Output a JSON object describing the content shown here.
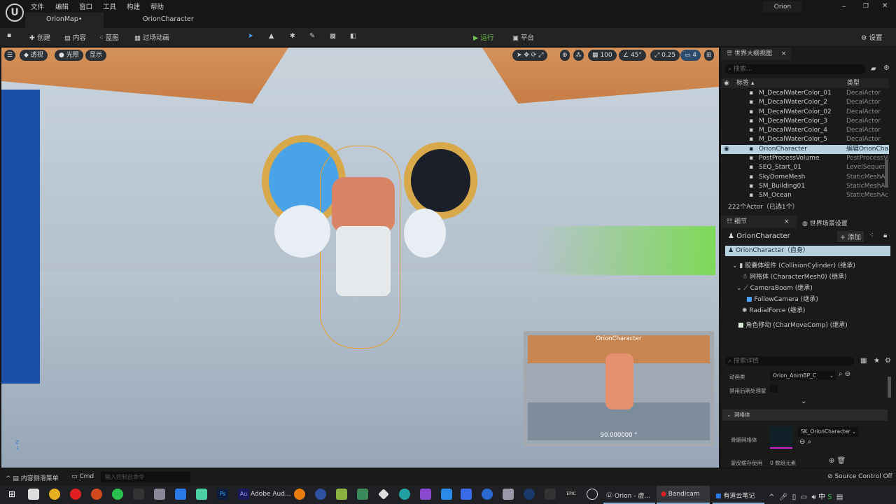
{
  "menu": [
    "文件",
    "编辑",
    "窗口",
    "工具",
    "构建",
    "帮助"
  ],
  "tabs": [
    {
      "label": "OrionMap•"
    },
    {
      "label": "OrionCharacter"
    }
  ],
  "project": "Orion",
  "toolbar": {
    "create": "创建",
    "content": "内容",
    "blueprint": "蓝图",
    "cinematics": "过场动画",
    "play": "运行",
    "platform": "平台",
    "settings": "设置"
  },
  "viewport": {
    "perspective": "透视",
    "lighting": "光照",
    "show": "显示",
    "grid": "100",
    "angle": "45°",
    "scale": "0.25",
    "camera_speed": "4",
    "preview_title": "OrionCharacter",
    "preview_value": "90.000000 °"
  },
  "outliner": {
    "title": "世界大纲视图",
    "search_placeholder": "搜索...",
    "col_label": "标签",
    "col_type": "类型",
    "rows": [
      {
        "name": "M_DecalWaterColor_01",
        "type": "DecalActor"
      },
      {
        "name": "M_DecalWaterColor_2",
        "type": "DecalActor"
      },
      {
        "name": "M_DecalWaterColor_02",
        "type": "DecalActor"
      },
      {
        "name": "M_DecalWaterColor_3",
        "type": "DecalActor"
      },
      {
        "name": "M_DecalWaterColor_4",
        "type": "DecalActor"
      },
      {
        "name": "M_DecalWaterColor_5",
        "type": "DecalActor"
      },
      {
        "name": "OrionCharacter",
        "type": "编辑OrionChar"
      },
      {
        "name": "PostProcessVolume",
        "type": "PostProcessVo"
      },
      {
        "name": "SEQ_Start_01",
        "type": "LevelSequence"
      },
      {
        "name": "SkyDomeMesh",
        "type": "StaticMeshAct"
      },
      {
        "name": "SM_Building01",
        "type": "StaticMeshAct"
      },
      {
        "name": "SM_Ocean",
        "type": "StaticMeshAct"
      }
    ],
    "count": "222个Actor（已选1个）"
  },
  "details": {
    "tab": "细节",
    "tab2": "世界场景设置",
    "actor": "OrionCharacter",
    "add": "添加",
    "self": "OrionCharacter（自身）",
    "components": [
      "胶囊体组件 (CollisionCylinder) (继承)",
      "网格体 (CharacterMesh0) (继承)",
      "CameraBoom (继承)",
      "FollowCamera (继承)",
      "RadialForce (继承)",
      "角色移动 (CharMoveComp) (继承)"
    ],
    "search_placeholder": "搜索详情",
    "anim_class_label": "动画类",
    "anim_class": "Orion_AnimBP_C",
    "disable_pp_label": "禁用后期处理蒙",
    "mesh_section": "网格体",
    "skeletal_mesh_label": "骨骼网格体",
    "skeletal_mesh": "SK_OrionCharacter",
    "skin_cache_label": "蒙皮缓存使用",
    "skin_cache_value": "0 数组元素"
  },
  "status": {
    "content_drawer": "内容侧滑菜单",
    "cmd": "Cmd",
    "cmd_placeholder": "输入控制台命令",
    "source_control": "Source Control Off"
  },
  "taskbar": {
    "audition": "Adobe Aud...",
    "unreal": "Orion - 虚...",
    "bandicam": "Bandicam",
    "youdao": "有道云笔记",
    "ime": "中"
  }
}
